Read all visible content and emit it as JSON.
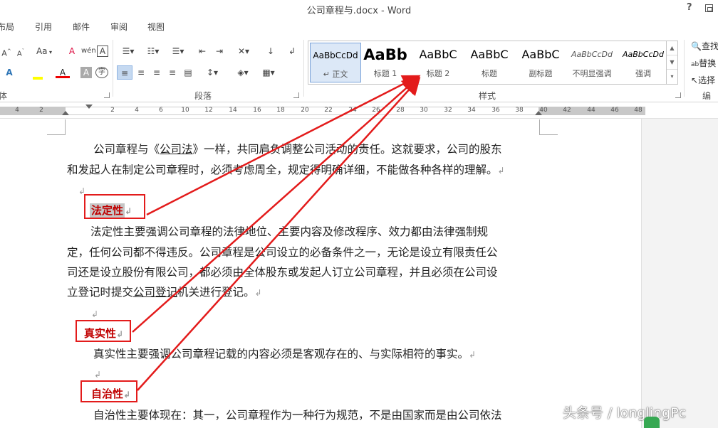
{
  "window": {
    "title": "公司章程与.docx - Word",
    "help": "?"
  },
  "tabs": [
    "布局",
    "引用",
    "邮件",
    "审阅",
    "视图"
  ],
  "ribbon": {
    "font_group_label": "体",
    "paragraph_group_label": "段落",
    "styles_group_label": "样式",
    "editing_group_label": "编辑",
    "font_case_label": "Aa",
    "styles": [
      {
        "sample": "AaBbCcDd",
        "name": "↵ 正文",
        "selected": true
      },
      {
        "sample": "AaBb",
        "name": "标题 1"
      },
      {
        "sample": "AaBbC",
        "name": "标题 2"
      },
      {
        "sample": "AaBbC",
        "name": "标题"
      },
      {
        "sample": "AaBbC",
        "name": "副标题"
      },
      {
        "sample": "AaBbCcDd",
        "name": "不明显强调"
      },
      {
        "sample": "AaBbCcDd",
        "name": "强调"
      }
    ],
    "editing": [
      "查找",
      "替换",
      "选择"
    ]
  },
  "ruler": {
    "ticks": [
      "4",
      "2",
      "2",
      "4",
      "6",
      "8",
      "10",
      "12",
      "14",
      "16",
      "18",
      "20",
      "22",
      "24",
      "26",
      "28",
      "30",
      "32",
      "34",
      "36",
      "38",
      "40",
      "42",
      "44",
      "46",
      "48"
    ]
  },
  "document": {
    "p1_line1_a": "公司章程与《",
    "p1_line1_link": "公司法",
    "p1_line1_b": "》一样，共同肩负调整公司活动的责任。这就要求，公司的股东",
    "p1_line2": "和发起人在制定公司章程时，必须考虑周全，规定得明确详细，不能做各种各样的理解。",
    "heading1": "法定性",
    "p2_line1": "法定性主要强调公司章程的法律地位、主要内容及修改程序、效力都由法律强制规",
    "p2_line2": "定，任何公司都不得违反。公司章程是公司设立的必备条件之一，无论是设立有限责任公",
    "p2_line3": "司还是设立股份有限公司，都必须由全体股东或发起人订立公司章程，并且必须在公司设",
    "p2_line4_a": "立登记时提交",
    "p2_line4_link": "公司登记",
    "p2_line4_b": "机关进行登记。",
    "heading2": "真实性",
    "p3_line1": "真实性主要强调公司章程记载的内容必须是客观存在的、与实际相符的事实。",
    "heading3": "自治性",
    "p4_line1": "自治性主要体现在：其一，公司章程作为一种行为规范，不是由国家而是由公司依法"
  },
  "watermark": "头条号 / longlingPc",
  "annotation_color": "#e31b1b"
}
